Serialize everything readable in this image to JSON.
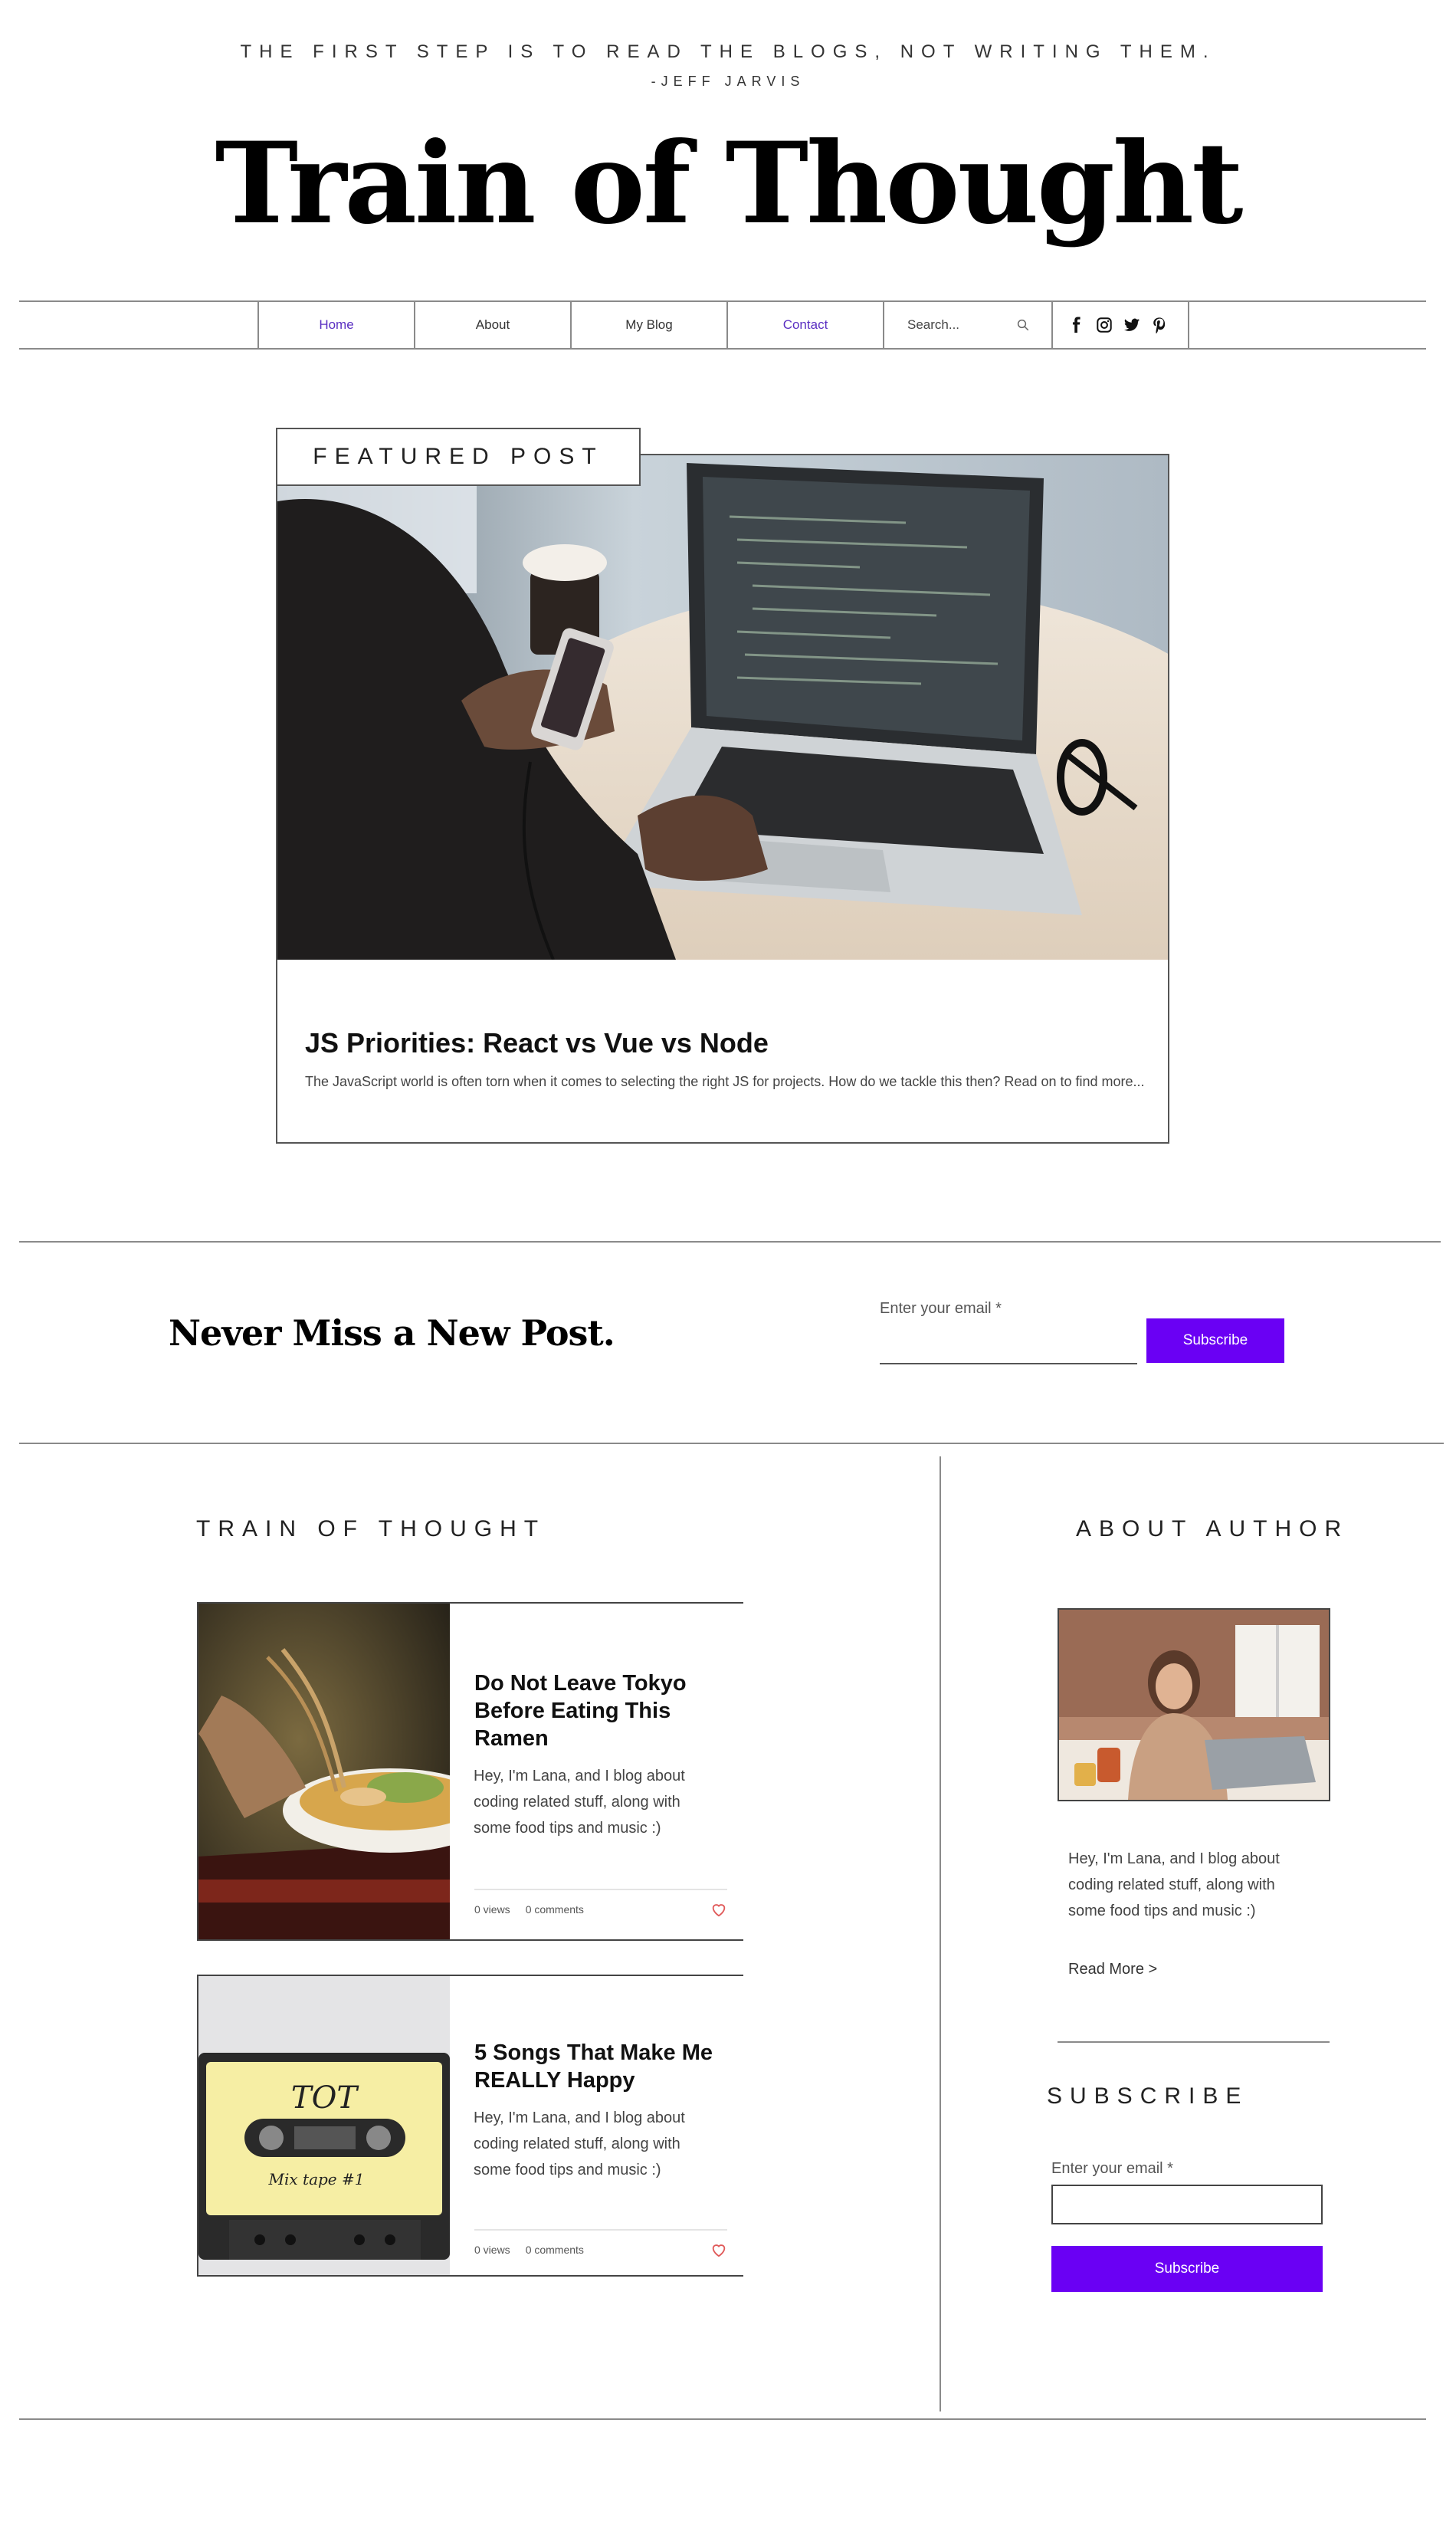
{
  "header": {
    "quote": "THE FIRST STEP IS TO READ THE BLOGS, NOT WRITING THEM.",
    "quote_author": "-JEFF JARVIS",
    "site_title": "Train of Thought"
  },
  "nav": {
    "items": [
      {
        "label": "Home"
      },
      {
        "label": "About"
      },
      {
        "label": "My Blog"
      },
      {
        "label": "Contact"
      }
    ],
    "search_placeholder": "Search...",
    "social_icons": [
      "facebook-icon",
      "instagram-icon",
      "twitter-icon",
      "pinterest-icon"
    ]
  },
  "featured": {
    "tab_label": "FEATURED POST",
    "title": "JS Priorities: React vs Vue vs Node",
    "excerpt": "The JavaScript world is often torn when it comes to selecting the right JS for projects. How do we tackle this then? Read on to find more..."
  },
  "newsletter": {
    "heading": "Never Miss a New Post.",
    "email_label": "Enter your email *",
    "button_label": "Subscribe"
  },
  "blog": {
    "heading": "TRAIN OF THOUGHT",
    "posts": [
      {
        "title": "Do Not Leave Tokyo Before Eating This Ramen",
        "excerpt": "Hey, I'm Lana, and I blog about coding related stuff, along with some food tips and music :)",
        "views": "0 views",
        "comments": "0 comments",
        "image": "ramen-photo"
      },
      {
        "title": "5 Songs That Make Me REALLY Happy",
        "excerpt": "Hey, I'm Lana, and I blog about coding related stuff, along with some food tips and music :)",
        "views": "0 views",
        "comments": "0 comments",
        "image": "cassette-photo",
        "cassette_label": "TOT",
        "cassette_sublabel": "Mix tape #1"
      }
    ]
  },
  "sidebar": {
    "about_heading": "ABOUT AUTHOR",
    "bio": "Hey, I'm Lana, and I blog about coding related stuff, along with some food tips and music :)",
    "read_more": "Read More >",
    "subscribe_heading": "SUBSCRIBE",
    "email_label": "Enter your email *",
    "button_label": "Subscribe"
  },
  "colors": {
    "accent": "#6a00f4",
    "nav_active": "#5a2fc2",
    "heart": "#e05a5a"
  }
}
